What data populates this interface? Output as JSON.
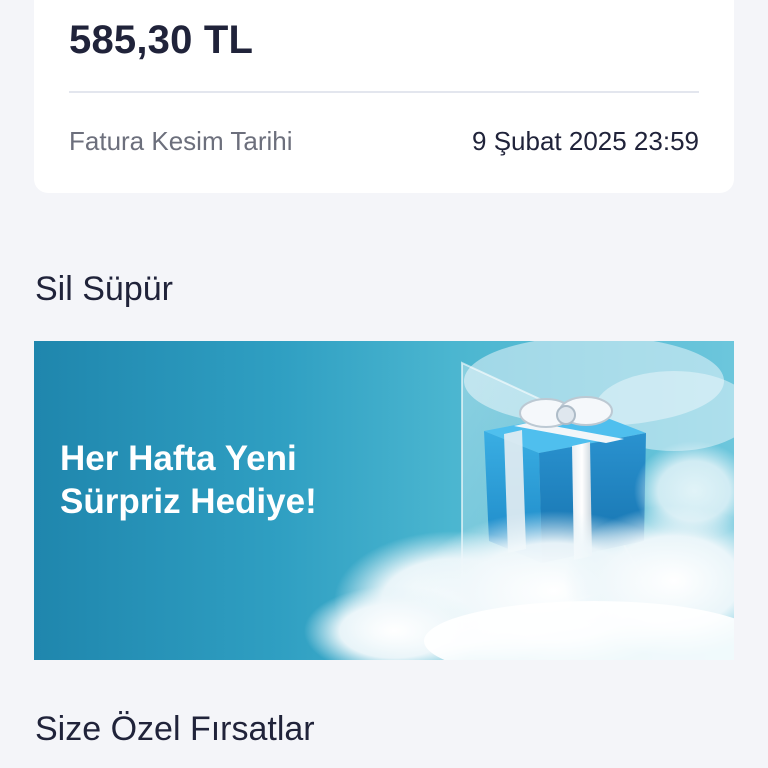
{
  "invoice_card": {
    "amount": "585,30 TL",
    "due_label": "Fatura Kesim Tarihi",
    "due_value": "9 Şubat 2025 23:59"
  },
  "sections": {
    "sil_supur_title": "Sil Süpür",
    "special_offers_title": "Size Özel Fırsatlar"
  },
  "banner": {
    "line1": "Her Hafta Yeni",
    "line2": "Sürpriz Hediye!",
    "icon": "gift-box-icon"
  },
  "colors": {
    "background": "#f4f5f9",
    "card": "#ffffff",
    "banner_gradient_start": "#1f86ad",
    "banner_gradient_end": "#6cc6dc",
    "gift_blue": "#2c9fd6"
  }
}
